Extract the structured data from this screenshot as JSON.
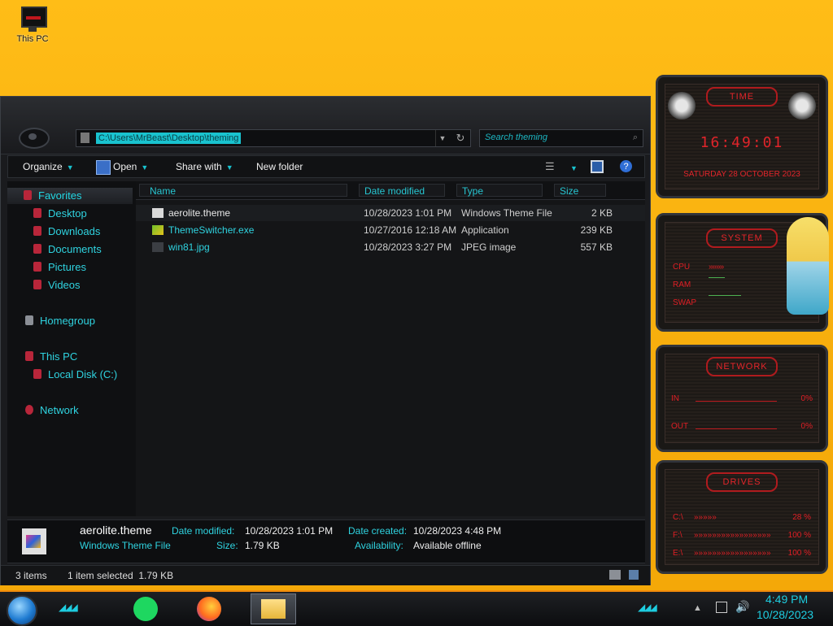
{
  "desktop": {
    "icon_label": "This PC"
  },
  "explorer": {
    "address": "C:\\Users\\MrBeast\\Desktop\\theming",
    "search_placeholder": "Search theming",
    "toolbar": {
      "organize": "Organize",
      "open": "Open",
      "share_with": "Share with",
      "new_folder": "New folder"
    },
    "nav": {
      "favorites": "Favorites",
      "desktop": "Desktop",
      "downloads": "Downloads",
      "documents": "Documents",
      "pictures": "Pictures",
      "videos": "Videos",
      "homegroup": "Homegroup",
      "this_pc": "This PC",
      "local_disk": "Local Disk (C:)",
      "network": "Network"
    },
    "columns": {
      "name": "Name",
      "date": "Date modified",
      "type": "Type",
      "size": "Size"
    },
    "files": [
      {
        "name": "aerolite.theme",
        "date": "10/28/2023 1:01 PM",
        "type": "Windows Theme File",
        "size": "2 KB"
      },
      {
        "name": "ThemeSwitcher.exe",
        "date": "10/27/2016 12:18 AM",
        "type": "Application",
        "size": "239 KB"
      },
      {
        "name": "win81.jpg",
        "date": "10/28/2023 3:27 PM",
        "type": "JPEG image",
        "size": "557 KB"
      }
    ],
    "details": {
      "filename": "aerolite.theme",
      "filetype": "Windows Theme File",
      "date_modified_label": "Date modified:",
      "date_modified": "10/28/2023 1:01 PM",
      "size_label": "Size:",
      "size": "1.79 KB",
      "date_created_label": "Date created:",
      "date_created": "10/28/2023 4:48 PM",
      "availability_label": "Availability:",
      "availability": "Available offline"
    },
    "status": {
      "items": "3 items",
      "selected": "1 item selected  1.79 KB"
    }
  },
  "gadgets": {
    "time": {
      "title": "TIME",
      "clock": "16:49:01",
      "date": "saturday 28 october 2023"
    },
    "system": {
      "title": "SYSTEM",
      "cpu": "CPU",
      "ram": "RAM",
      "swap": "SWAP"
    },
    "network": {
      "title": "NETWORK",
      "in": "IN",
      "out": "OUT",
      "in_val": "0%",
      "out_val": "0%"
    },
    "drives": {
      "title": "DRIVES",
      "c": "C:\\",
      "f": "F:\\",
      "e": "E:\\",
      "c_val": "28 %",
      "f_val": "100 %",
      "e_val": "100 %"
    }
  },
  "taskbar": {
    "time": "4:49 PM",
    "date": "10/28/2023"
  },
  "colors": {
    "accent": "#19c3cf",
    "desktop": "#ffbd17",
    "gadget_red": "#e01f25"
  }
}
